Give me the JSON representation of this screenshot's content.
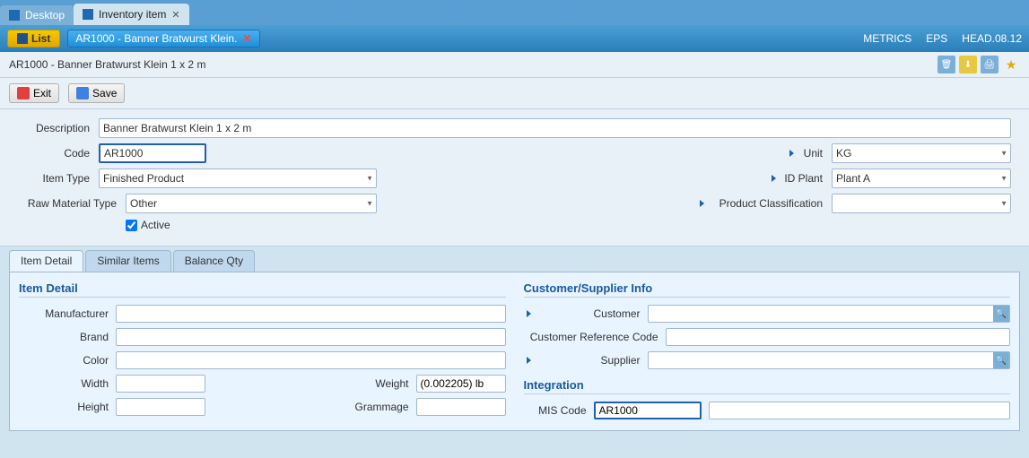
{
  "tabs": [
    {
      "id": "desktop",
      "label": "Desktop",
      "active": false
    },
    {
      "id": "inventory",
      "label": "Inventory item",
      "active": true,
      "closeable": true
    }
  ],
  "toolbar": {
    "list_label": "List",
    "record_label": "AR1000 - Banner Bratwurst Klein.",
    "metrics_label": "METRICS",
    "eps_label": "EPS",
    "head_label": "HEAD.08.12"
  },
  "breadcrumb": {
    "text": "AR1000 - Banner Bratwurst Klein 1 x 2 m"
  },
  "actions": {
    "exit_label": "Exit",
    "save_label": "Save"
  },
  "form": {
    "description_label": "Description",
    "description_value": "Banner Bratwurst Klein 1 x 2 m",
    "code_label": "Code",
    "code_value": "AR1000",
    "unit_label": "Unit",
    "unit_value": "KG",
    "item_type_label": "Item Type",
    "item_type_value": "Finished Product",
    "id_plant_label": "ID Plant",
    "id_plant_value": "Plant A",
    "raw_material_type_label": "Raw Material Type",
    "raw_material_type_value": "Other",
    "product_classification_label": "Product Classification",
    "product_classification_value": "",
    "active_label": "Active",
    "active_checked": true
  },
  "main_tabs": [
    {
      "id": "item-detail",
      "label": "Item Detail",
      "active": true
    },
    {
      "id": "similar-items",
      "label": "Similar Items",
      "active": false
    },
    {
      "id": "balance-qty",
      "label": "Balance Qty",
      "active": false
    }
  ],
  "item_detail": {
    "section_title": "Item Detail",
    "manufacturer_label": "Manufacturer",
    "manufacturer_value": "",
    "brand_label": "Brand",
    "brand_value": "",
    "color_label": "Color",
    "color_value": "",
    "width_label": "Width",
    "width_value": "",
    "weight_label": "Weight",
    "weight_value": "(0.002205) lb",
    "height_label": "Height",
    "height_value": "",
    "grammage_label": "Grammage",
    "grammage_value": ""
  },
  "customer_supplier": {
    "section_title": "Customer/Supplier Info",
    "customer_label": "Customer",
    "customer_value": "",
    "customer_ref_code_label": "Customer Reference Code",
    "customer_ref_code_value": "",
    "supplier_label": "Supplier",
    "supplier_value": ""
  },
  "integration": {
    "section_title": "Integration",
    "mis_code_label": "MIS Code",
    "mis_code_value": "AR1000",
    "mis_code_ext_value": ""
  }
}
